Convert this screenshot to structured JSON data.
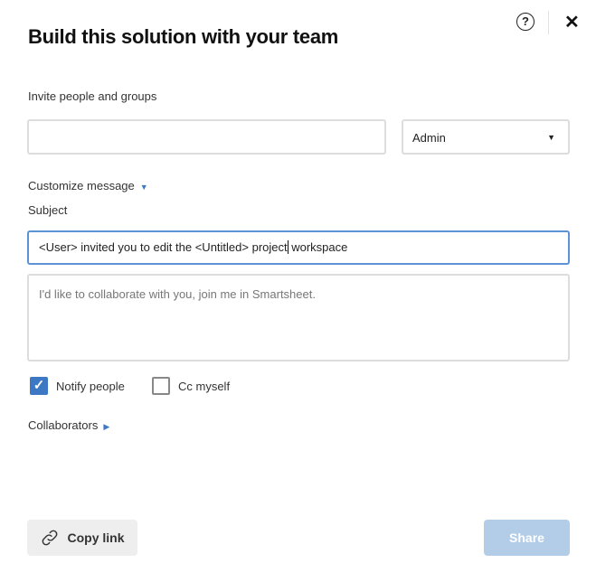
{
  "dialog": {
    "title": "Build this solution with your team",
    "help_icon": "?",
    "close_icon": "✕"
  },
  "invite": {
    "label": "Invite people and groups",
    "input_value": "",
    "input_placeholder": "",
    "role": "Admin"
  },
  "message": {
    "toggle_label": "Customize message",
    "subject_label": "Subject",
    "subject_before_caret": "<User> invited you to edit the <Untitled> project",
    "subject_after_caret": " workspace",
    "body_placeholder": "I'd like to collaborate with you, join me in Smartsheet."
  },
  "options": {
    "notify_label": "Notify people",
    "notify_checked": true,
    "cc_label": "Cc myself",
    "cc_checked": false
  },
  "collaborators": {
    "label": "Collaborators"
  },
  "footer": {
    "copy_link": "Copy link",
    "share": "Share"
  },
  "colors": {
    "accent": "#3c78c4",
    "share_disabled": "#b3cde9"
  }
}
